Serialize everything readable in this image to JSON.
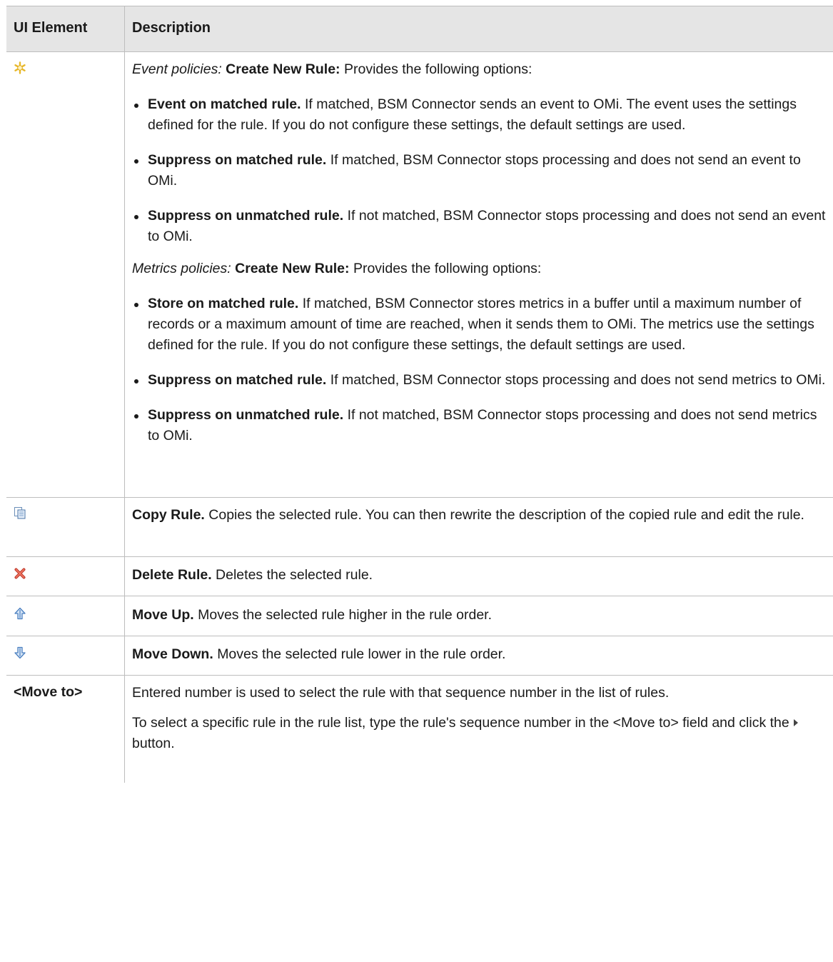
{
  "table": {
    "header": {
      "col1": "UI Element",
      "col2": "Description"
    },
    "rows": {
      "create": {
        "icon": "create-new-rule-icon",
        "event_intro": {
          "italic": "Event policies:",
          "bold": "Create New Rule:",
          "rest": "Provides the following options:"
        },
        "event_items": [
          {
            "bold": "Event on matched rule.",
            "text": "If matched, BSM Connector sends an event to OMi. The event uses the settings defined for the rule. If you do not configure these settings, the default settings are used."
          },
          {
            "bold": "Suppress on matched rule.",
            "text": "If matched, BSM Connector stops processing and does not send an event to OMi."
          },
          {
            "bold": "Suppress on unmatched rule.",
            "text": "If not matched, BSM Connector  stops processing and does not send an event to OMi."
          }
        ],
        "metrics_intro": {
          "italic": "Metrics policies:",
          "bold": "Create New Rule:",
          "rest": "Provides the following options:"
        },
        "metrics_items": [
          {
            "bold": "Store on matched rule.",
            "text": "If matched, BSM Connector stores metrics in a buffer until a maximum number of records or a maximum amount of time are reached, when it sends them to OMi. The metrics use the settings defined for the rule. If you do not configure these settings, the default settings are used."
          },
          {
            "bold": "Suppress on matched rule.",
            "text": "If matched, BSM Connector stops processing and does not send metrics to OMi."
          },
          {
            "bold": "Suppress on unmatched rule.",
            "text": "If not matched, BSM Connector stops processing and does not send metrics to OMi."
          }
        ]
      },
      "copy": {
        "icon": "copy-rule-icon",
        "bold": "Copy Rule.",
        "text": "Copies the selected rule. You can then rewrite the description of the copied rule and edit the rule."
      },
      "delete": {
        "icon": "delete-rule-icon",
        "bold": "Delete Rule.",
        "text": "Deletes the selected rule."
      },
      "up": {
        "icon": "move-up-icon",
        "bold": "Move Up.",
        "text": "Moves the selected rule higher in the rule order."
      },
      "down": {
        "icon": "move-down-icon",
        "bold": "Move Down.",
        "text": "Moves the selected rule lower in the rule order."
      },
      "moveto": {
        "label": "<Move to>",
        "p1": "Entered number is used to select the rule with that sequence number in the list of rules.",
        "p2_before": "To select a specific rule in the rule list, type the rule's sequence number in the <Move to> field and click the",
        "p2_after": "button.",
        "inline_icon": "play-arrow-icon"
      }
    }
  }
}
